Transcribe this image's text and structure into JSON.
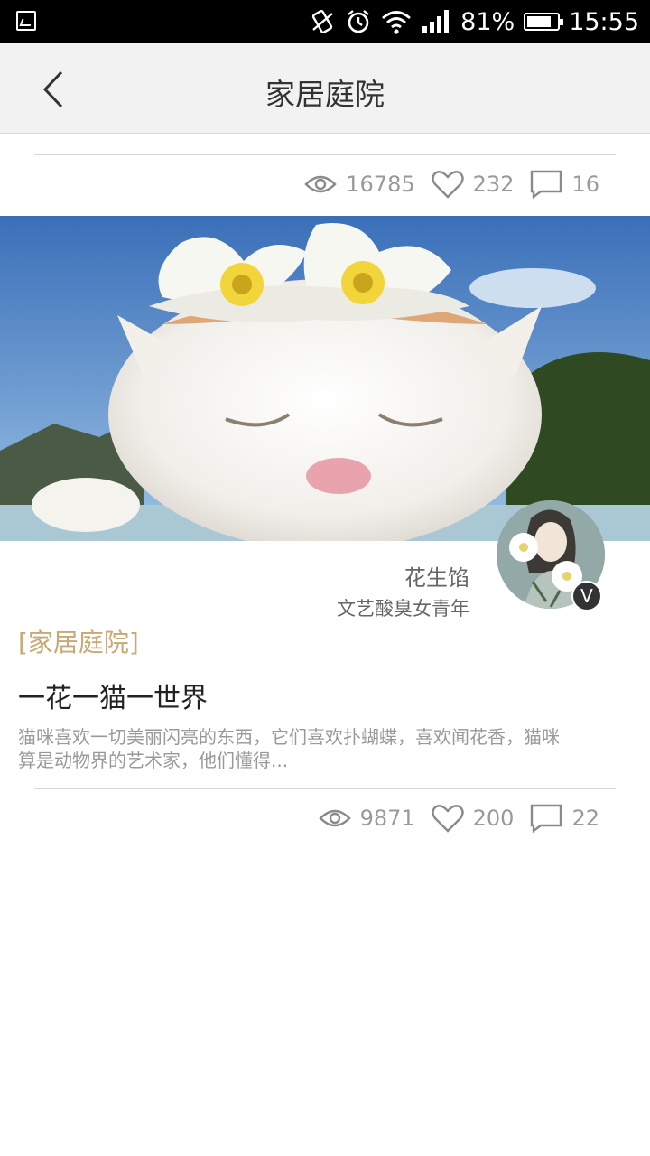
{
  "status_bar": {
    "battery_percent": "81%",
    "time": "15:55",
    "battery_level": 0.81
  },
  "nav": {
    "title": "家居庭院"
  },
  "prev_post": {
    "views": "16785",
    "likes": "232",
    "comments": "16"
  },
  "post": {
    "author_name": "花生馅",
    "author_desc": "文艺酸臭女青年",
    "verified_badge": "V",
    "category": "[家居庭院]",
    "title": "一花一猫一世界",
    "excerpt": "猫咪喜欢一切美丽闪亮的东西，它们喜欢扑蝴蝶，喜欢闻花香，猫咪算是动物界的艺术家，他们懂得...",
    "views": "9871",
    "likes": "200",
    "comments": "22"
  },
  "colors": {
    "accent": "#c9a875",
    "muted": "#9a9a9a",
    "navbar_bg": "#f2f2f2"
  }
}
